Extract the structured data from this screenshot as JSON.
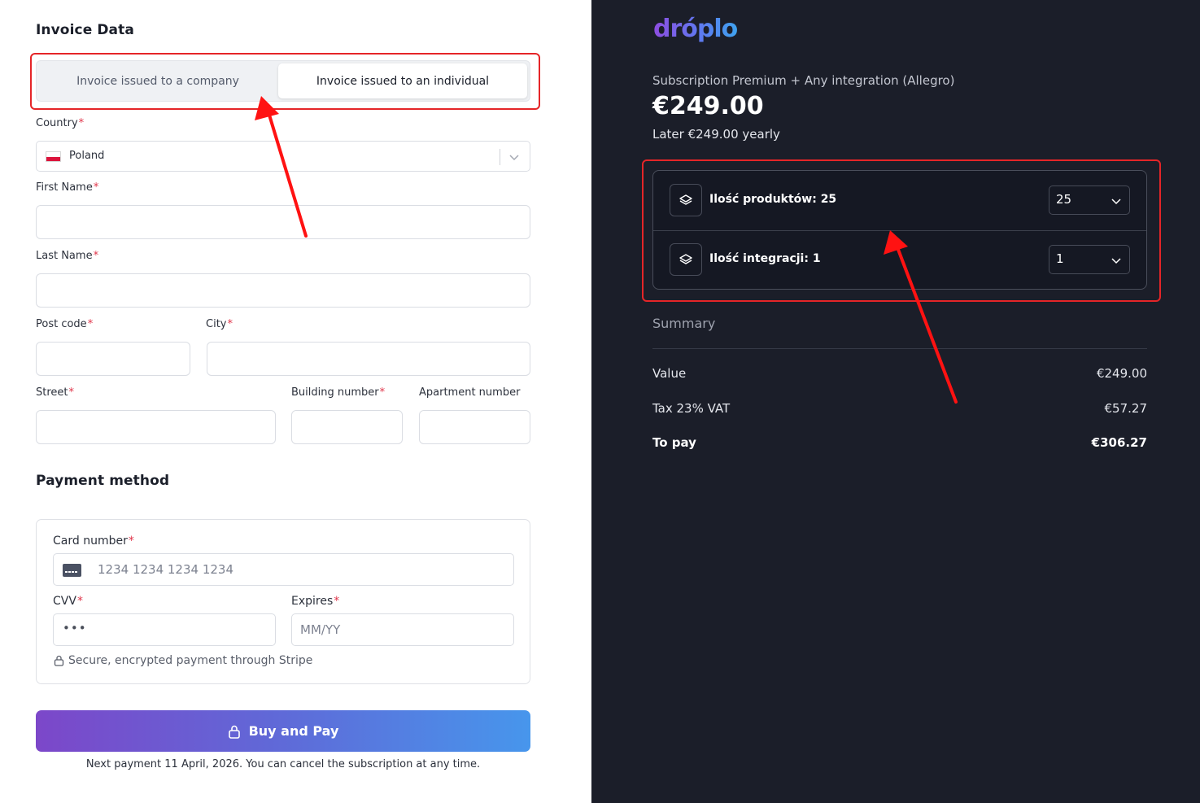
{
  "invoice": {
    "title": "Invoice Data",
    "tabs": [
      {
        "label": "Invoice issued to a company",
        "selected": false
      },
      {
        "label": "Invoice issued to an individual",
        "selected": true
      }
    ],
    "required_mark": "*",
    "fields": {
      "country": {
        "label": "Country",
        "value": "Poland"
      },
      "first_name": {
        "label": "First Name",
        "value": ""
      },
      "last_name": {
        "label": "Last Name",
        "value": ""
      },
      "post_code": {
        "label": "Post code",
        "value": ""
      },
      "city": {
        "label": "City",
        "value": ""
      },
      "street": {
        "label": "Street",
        "value": ""
      },
      "building_number": {
        "label": "Building number",
        "value": ""
      },
      "apartment_number": {
        "label": "Apartment number",
        "value": ""
      }
    }
  },
  "payment": {
    "title": "Payment method",
    "card_number": {
      "label": "Card number",
      "placeholder": "1234 1234 1234 1234"
    },
    "cvv": {
      "label": "CVV",
      "placeholder": "•••"
    },
    "expires": {
      "label": "Expires",
      "placeholder": "MM/YY"
    },
    "secure_note": "Secure, encrypted payment through Stripe",
    "buy_button": "Buy and Pay",
    "next_payment_note": "Next payment 11 April, 2026. You can cancel the subscription at any time."
  },
  "order": {
    "logo": "dróplo",
    "subscription": "Subscription Premium + Any integration (Allegro)",
    "price": "€249.00",
    "later": "Later €249.00 yearly",
    "options": [
      {
        "label": "Ilość produktów: 25",
        "value": "25"
      },
      {
        "label": "Ilość integracji: 1",
        "value": "1"
      }
    ],
    "summary_title": "Summary",
    "rows": [
      {
        "label": "Value",
        "amount": "€249.00"
      },
      {
        "label": "Tax 23% VAT",
        "amount": "€57.27"
      },
      {
        "label": "To pay",
        "amount": "€306.27"
      }
    ]
  },
  "colors": {
    "accent_gradient_start": "#7c47c9",
    "accent_gradient_end": "#4796ec",
    "highlight_red": "#e52528",
    "right_panel_bg": "#1b1e29",
    "required": "#e0354a"
  }
}
